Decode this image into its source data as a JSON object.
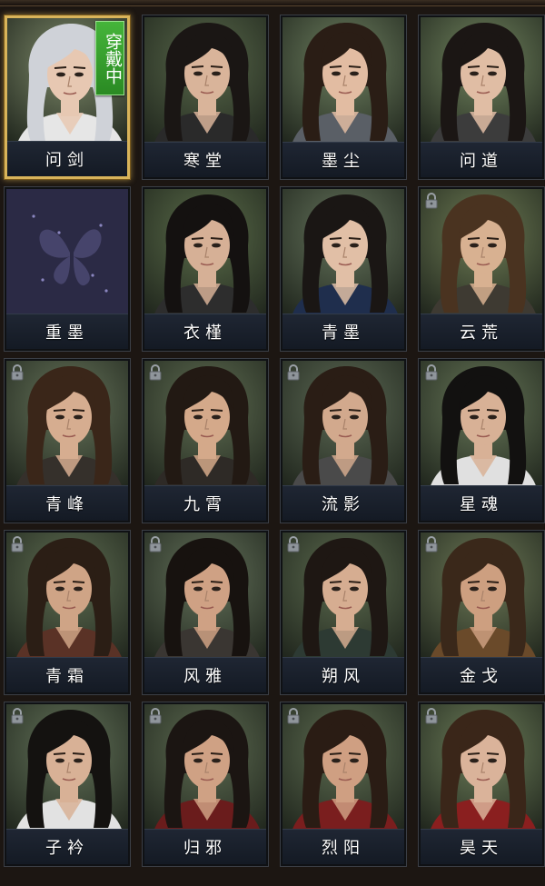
{
  "badge_equipped": "穿戴中",
  "characters": [
    {
      "name": "问剑",
      "locked": false,
      "selected": true,
      "hair": "#cfd2d8",
      "bg": "#7e8a6a",
      "skin": "#e7c8b2",
      "robe": "#e6e6e6",
      "placeholder": false
    },
    {
      "name": "寒堂",
      "locked": false,
      "selected": false,
      "hair": "#1a1614",
      "bg": "#58684a",
      "skin": "#d9b49a",
      "robe": "#2a2a2a",
      "placeholder": false
    },
    {
      "name": "墨尘",
      "locked": false,
      "selected": false,
      "hair": "#2a1d15",
      "bg": "#6e8060",
      "skin": "#e2bca2",
      "robe": "#5a5f66",
      "placeholder": false
    },
    {
      "name": "问道",
      "locked": false,
      "selected": false,
      "hair": "#1b1614",
      "bg": "#72855f",
      "skin": "#e0bda4",
      "robe": "#3c3c3c",
      "placeholder": false
    },
    {
      "name": "重墨",
      "locked": false,
      "selected": false,
      "hair": "#2b2a45",
      "bg": "#2b2a45",
      "skin": "#e0bda4",
      "robe": "#2b2a45",
      "placeholder": true
    },
    {
      "name": "衣槿",
      "locked": false,
      "selected": false,
      "hair": "#141110",
      "bg": "#5b6d4a",
      "skin": "#d6b096",
      "robe": "#2d2d2d",
      "placeholder": false
    },
    {
      "name": "青墨",
      "locked": false,
      "selected": false,
      "hair": "#1a1614",
      "bg": "#65745c",
      "skin": "#e1bfa6",
      "robe": "#1f2e4d",
      "placeholder": false
    },
    {
      "name": "云荒",
      "locked": true,
      "selected": false,
      "hair": "#4a3320",
      "bg": "#6f7d55",
      "skin": "#d8b191",
      "robe": "#3e3a32",
      "placeholder": false
    },
    {
      "name": "青峰",
      "locked": true,
      "selected": false,
      "hair": "#3a2619",
      "bg": "#66745a",
      "skin": "#d6ad90",
      "robe": "#35302b",
      "placeholder": false
    },
    {
      "name": "九霄",
      "locked": true,
      "selected": false,
      "hair": "#221913",
      "bg": "#5f6d52",
      "skin": "#d4a98a",
      "robe": "#2e2a26",
      "placeholder": false
    },
    {
      "name": "流影",
      "locked": true,
      "selected": false,
      "hair": "#2a1d15",
      "bg": "#5d6a55",
      "skin": "#d2a98d",
      "robe": "#4a4a4a",
      "placeholder": false
    },
    {
      "name": "星魂",
      "locked": true,
      "selected": false,
      "hair": "#121110",
      "bg": "#677758",
      "skin": "#d8b196",
      "robe": "#e0e0e0",
      "placeholder": false
    },
    {
      "name": "青霜",
      "locked": true,
      "selected": false,
      "hair": "#2b1e15",
      "bg": "#5f6e52",
      "skin": "#cfa486",
      "robe": "#5a3226",
      "placeholder": false
    },
    {
      "name": "风雅",
      "locked": true,
      "selected": false,
      "hair": "#17120f",
      "bg": "#63715a",
      "skin": "#cfa184",
      "robe": "#3a3632",
      "placeholder": false
    },
    {
      "name": "朔风",
      "locked": true,
      "selected": false,
      "hair": "#1e1713",
      "bg": "#5c6b4f",
      "skin": "#d6ad91",
      "robe": "#2d3a33",
      "placeholder": false
    },
    {
      "name": "金戈",
      "locked": true,
      "selected": false,
      "hair": "#3a281a",
      "bg": "#6e7a57",
      "skin": "#cd9f80",
      "robe": "#6a4a2a",
      "placeholder": false
    },
    {
      "name": "子衿",
      "locked": true,
      "selected": false,
      "hair": "#141210",
      "bg": "#64745a",
      "skin": "#d8b196",
      "robe": "#e2e2e2",
      "placeholder": false
    },
    {
      "name": "归邪",
      "locked": true,
      "selected": false,
      "hair": "#1b1512",
      "bg": "#5e6c52",
      "skin": "#cfa184",
      "robe": "#6a1c1c",
      "placeholder": false
    },
    {
      "name": "烈阳",
      "locked": true,
      "selected": false,
      "hair": "#2a1c14",
      "bg": "#5f6e52",
      "skin": "#cf9f82",
      "robe": "#7a1e1e",
      "placeholder": false
    },
    {
      "name": "昊天",
      "locked": true,
      "selected": false,
      "hair": "#3a2619",
      "bg": "#6e7f5a",
      "skin": "#dab39a",
      "robe": "#8a1f1f",
      "placeholder": false
    }
  ]
}
